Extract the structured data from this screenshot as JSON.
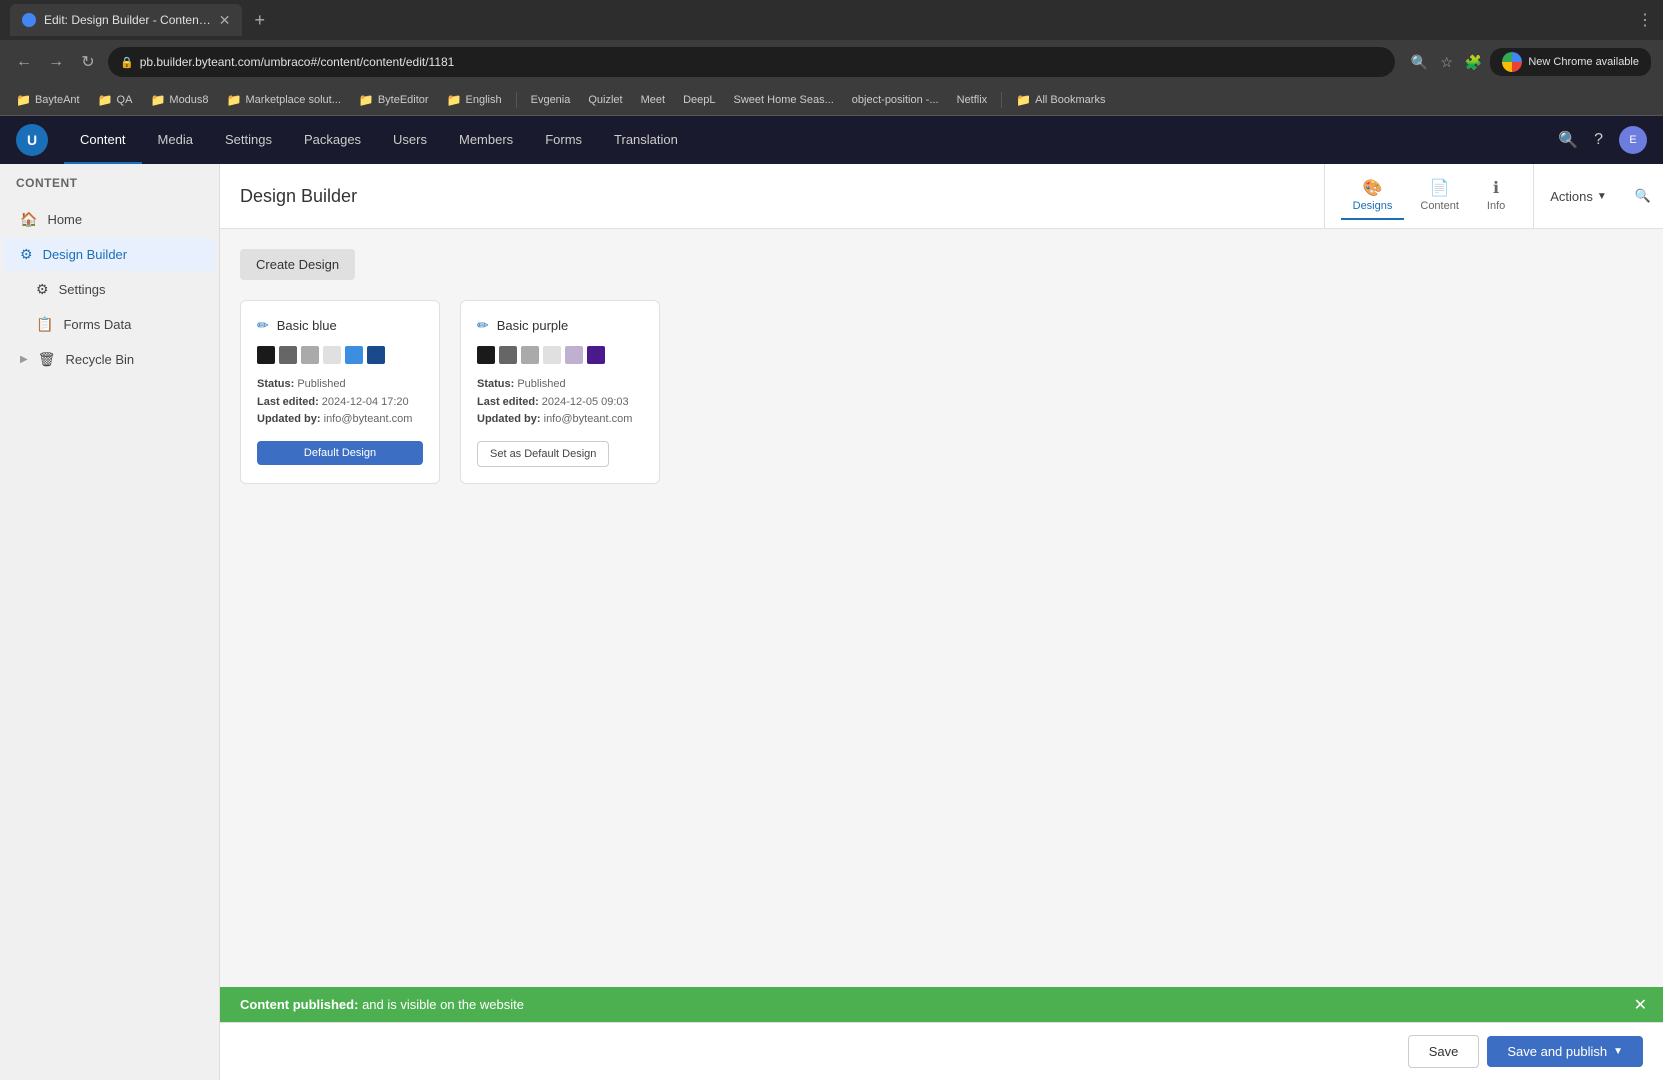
{
  "browser": {
    "tab_title": "Edit: Design Builder - Conten…",
    "address": "pb.builder.byteant.com/umbraco#/content/content/edit/1181",
    "new_chrome_label": "New Chrome available",
    "new_tab_label": "+",
    "bookmarks": [
      {
        "label": "BayteAnt",
        "type": "folder"
      },
      {
        "label": "QA",
        "type": "folder"
      },
      {
        "label": "Modus8",
        "type": "folder"
      },
      {
        "label": "Marketplace solut...",
        "type": "folder"
      },
      {
        "label": "ByteEditor",
        "type": "folder"
      },
      {
        "label": "English",
        "type": "folder"
      },
      {
        "label": "Evgenia",
        "type": "item"
      },
      {
        "label": "Quizlet",
        "type": "item"
      },
      {
        "label": "Meet",
        "type": "item"
      },
      {
        "label": "DeepL",
        "type": "item"
      },
      {
        "label": "Sweet Home Seas...",
        "type": "item"
      },
      {
        "label": "object-position -...",
        "type": "item"
      },
      {
        "label": "Netflix",
        "type": "item"
      },
      {
        "label": "All Bookmarks",
        "type": "folder"
      }
    ]
  },
  "topnav": {
    "items": [
      {
        "label": "Content",
        "active": true
      },
      {
        "label": "Media",
        "active": false
      },
      {
        "label": "Settings",
        "active": false
      },
      {
        "label": "Packages",
        "active": false
      },
      {
        "label": "Users",
        "active": false
      },
      {
        "label": "Members",
        "active": false
      },
      {
        "label": "Forms",
        "active": false
      },
      {
        "label": "Translation",
        "active": false
      }
    ]
  },
  "sidebar": {
    "header": "Content",
    "items": [
      {
        "label": "Home",
        "icon": "🏠",
        "active": false,
        "indent": 0
      },
      {
        "label": "Design Builder",
        "icon": "⚙",
        "active": true,
        "indent": 0
      },
      {
        "label": "Settings",
        "icon": "⚙",
        "active": false,
        "indent": 1
      },
      {
        "label": "Forms Data",
        "icon": "📋",
        "active": false,
        "indent": 1
      },
      {
        "label": "Recycle Bin",
        "icon": "🗑",
        "active": false,
        "indent": 0
      }
    ]
  },
  "page": {
    "title": "Design Builder",
    "tabs": [
      {
        "label": "Designs",
        "icon": "🎨",
        "active": true
      },
      {
        "label": "Content",
        "icon": "📄",
        "active": false
      },
      {
        "label": "Info",
        "icon": "ℹ",
        "active": false
      }
    ],
    "actions_label": "Actions",
    "create_design_label": "Create Design"
  },
  "designs": [
    {
      "name": "Basic blue",
      "swatches": [
        {
          "color": "#1a1a1a"
        },
        {
          "color": "#666666"
        },
        {
          "color": "#aaaaaa"
        },
        {
          "color": "#e0e0e0"
        },
        {
          "color": "#3c8ee0"
        },
        {
          "color": "#1a4a8c"
        }
      ],
      "status_label": "Status:",
      "status_value": "Published",
      "last_edited_label": "Last edited:",
      "last_edited_value": "2024-12-04 17:20",
      "updated_by_label": "Updated by:",
      "updated_by_value": "info@byteant.com",
      "button_label": "Default Design",
      "is_default": true
    },
    {
      "name": "Basic purple",
      "swatches": [
        {
          "color": "#1a1a1a"
        },
        {
          "color": "#666666"
        },
        {
          "color": "#aaaaaa"
        },
        {
          "color": "#e0e0e0"
        },
        {
          "color": "#c0b0d0"
        },
        {
          "color": "#4a1a8c"
        }
      ],
      "status_label": "Status:",
      "status_value": "Published",
      "last_edited_label": "Last edited:",
      "last_edited_value": "2024-12-05 09:03",
      "updated_by_label": "Updated by:",
      "updated_by_value": "info@byteant.com",
      "button_label": "Set as Default Design",
      "is_default": false
    }
  ],
  "notification": {
    "bold_text": "Content published:",
    "message": " and is visible on the website"
  },
  "bottom_bar": {
    "save_label": "Save",
    "save_publish_label": "Save and publish"
  }
}
